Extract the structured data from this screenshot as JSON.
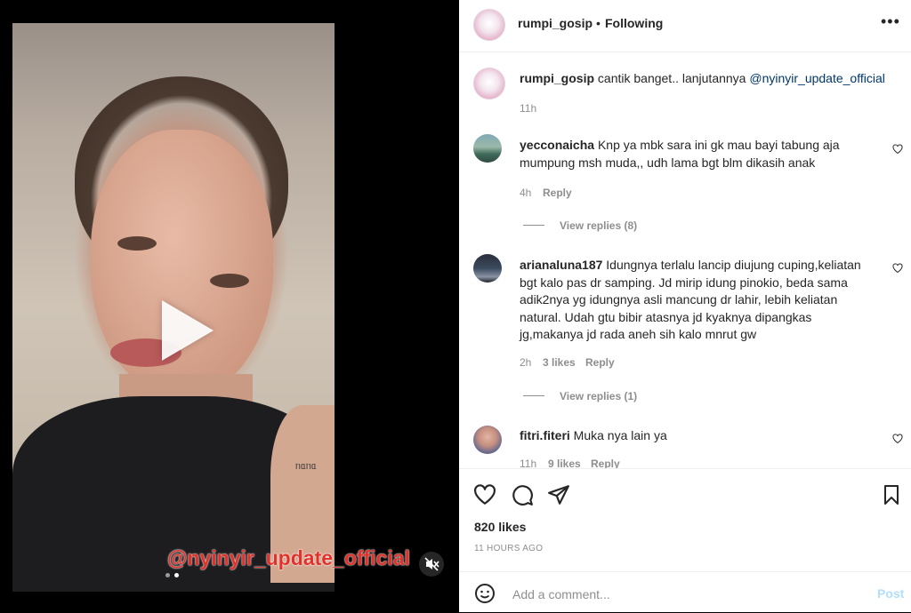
{
  "post": {
    "username": "rumpi_gosip",
    "separator": "•",
    "follow_status": "Following",
    "more_label": "•••",
    "video_overlay_text": "@nyinyir_update_official",
    "tattoo_text": "ᥒᥲᥒᥲ"
  },
  "caption": {
    "username": "rumpi_gosip",
    "text": "cantik banget.. lanjutannya ",
    "mention": "@nyinyir_update_official",
    "time": "11h"
  },
  "comments": [
    {
      "username": "yecconaicha",
      "text": "Knp ya mbk sara ini gk mau bayi tabung aja mumpung msh muda,, udh lama bgt blm dikasih anak",
      "time": "4h",
      "likes": "",
      "reply_label": "Reply",
      "view_replies": "View replies (8)"
    },
    {
      "username": "arianaluna187",
      "text": "Idungnya terlalu lancip diujung cuping,keliatan bgt kalo pas dr samping. Jd mirip idung pinokio, beda sama adik2nya yg idungnya asli mancung dr lahir, lebih keliatan natural. Udah gtu bibir atasnya jd kyaknya dipangkas jg,makanya jd rada aneh sih kalo mnrut gw",
      "time": "2h",
      "likes": "3 likes",
      "reply_label": "Reply",
      "view_replies": "View replies (1)"
    },
    {
      "username": "fitri.fiteri",
      "text": "Muka nya lain ya",
      "time": "11h",
      "likes": "9 likes",
      "reply_label": "Reply",
      "view_replies": ""
    }
  ],
  "stats": {
    "likes": "820 likes",
    "time_ago": "11 HOURS AGO"
  },
  "composer": {
    "placeholder": "Add a comment...",
    "post_label": "Post"
  },
  "icons": {
    "like": "heart-icon",
    "comment": "comment-bubble-icon",
    "share": "paper-plane-icon",
    "save": "bookmark-icon",
    "emoji": "emoji-icon",
    "mute": "muted-speaker-icon",
    "play": "play-icon"
  },
  "colors": {
    "text": "#262626",
    "muted": "#8e8e8e",
    "mention": "#00376b",
    "post_disabled": "#b2dffc",
    "overlay_tag": "#e0322a"
  }
}
